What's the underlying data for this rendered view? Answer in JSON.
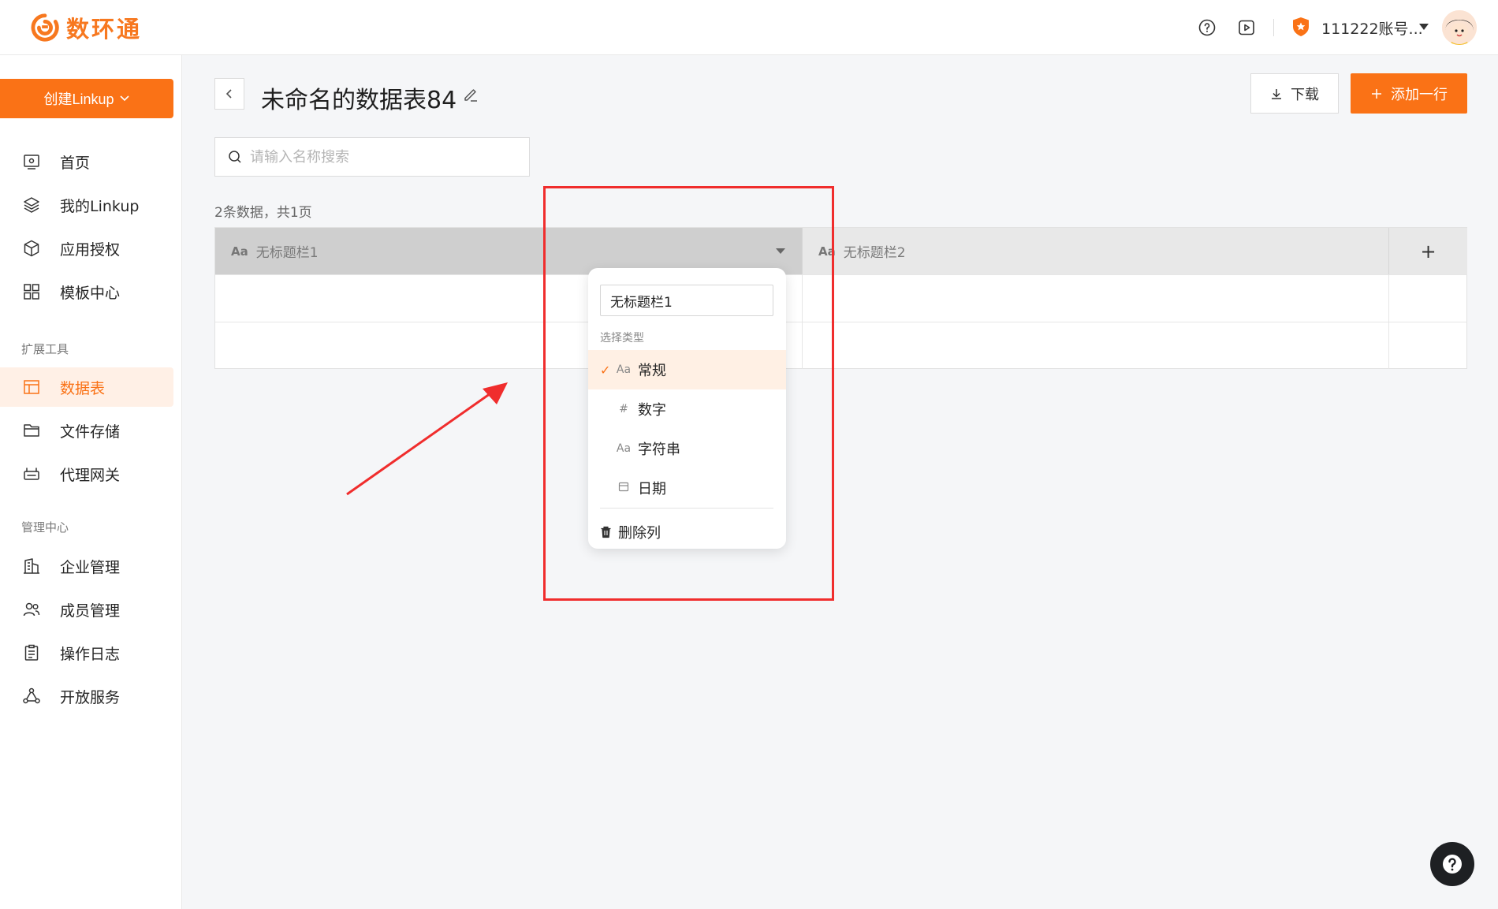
{
  "header": {
    "brand": "数环通",
    "account_name": "111222账号...",
    "colors": {
      "brand": "#f7781f",
      "accent": "#fa7216"
    },
    "icons": [
      "help-circle-icon",
      "video-play-icon",
      "vip-badge-icon",
      "chevron-down-icon",
      "avatar"
    ]
  },
  "sidebar": {
    "create_button": "创建Linkup",
    "items": [
      {
        "label": "首页",
        "icon": "monitor-icon"
      },
      {
        "label": "我的Linkup",
        "icon": "layers-icon"
      },
      {
        "label": "应用授权",
        "icon": "cube-icon"
      },
      {
        "label": "模板中心",
        "icon": "grid-icon"
      }
    ],
    "section_tools": "扩展工具",
    "tools": [
      {
        "label": "数据表",
        "icon": "table-icon",
        "active": true
      },
      {
        "label": "文件存储",
        "icon": "folder-icon"
      },
      {
        "label": "代理网关",
        "icon": "gateway-icon"
      }
    ],
    "section_admin": "管理中心",
    "admin": [
      {
        "label": "企业管理",
        "icon": "building-icon"
      },
      {
        "label": "成员管理",
        "icon": "users-icon"
      },
      {
        "label": "操作日志",
        "icon": "clipboard-icon"
      },
      {
        "label": "开放服务",
        "icon": "share-nodes-icon"
      }
    ]
  },
  "main": {
    "title": "未命名的数据表84",
    "download_label": "下载",
    "add_row_label": "添加一行",
    "search_placeholder": "请输入名称搜索",
    "record_count": "2条数据，共1页",
    "columns": [
      {
        "type_icon": "Aa",
        "name": "无标题栏1"
      },
      {
        "type_icon": "Aa",
        "name": "无标题栏2"
      }
    ],
    "add_column_symbol": "+",
    "rows": [
      [
        "",
        ""
      ],
      [
        "",
        ""
      ]
    ]
  },
  "column_menu": {
    "name_value": "无标题栏1",
    "type_label": "选择类型",
    "options": [
      {
        "icon": "Aa",
        "label": "常规",
        "selected": true
      },
      {
        "icon": "#",
        "label": "数字",
        "selected": false
      },
      {
        "icon": "Aa",
        "label": "字符串",
        "selected": false
      },
      {
        "icon": "calendar-icon",
        "label": "日期",
        "selected": false
      }
    ],
    "delete_label": "删除列"
  }
}
